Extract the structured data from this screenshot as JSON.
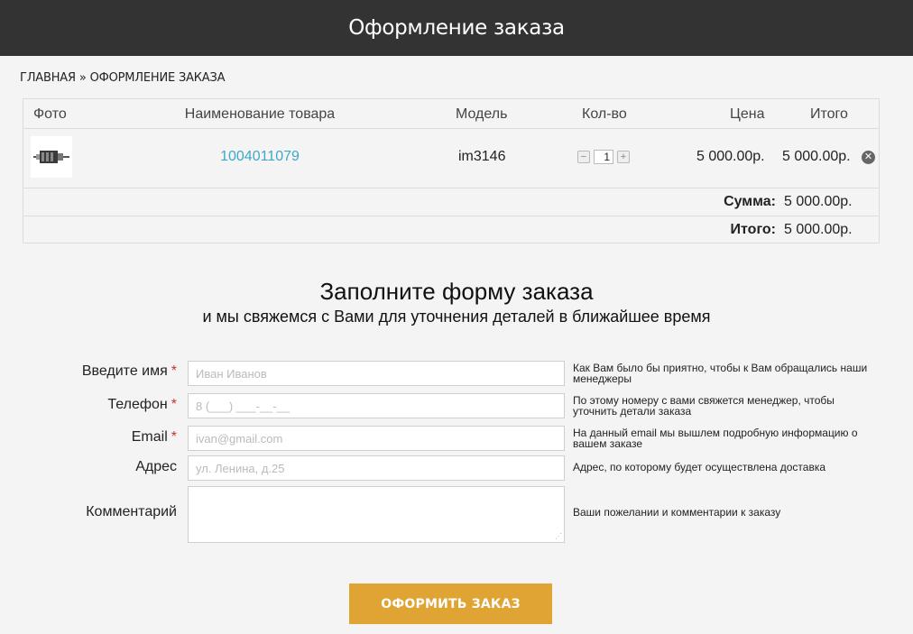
{
  "header": {
    "title": "Оформление заказа"
  },
  "breadcrumb": {
    "home": "Главная",
    "separator": "»",
    "current": "Оформление заказа"
  },
  "cart": {
    "columns": {
      "photo": "Фото",
      "name": "Наименование товара",
      "model": "Модель",
      "qty": "Кол-во",
      "price": "Цена",
      "total": "Итого"
    },
    "items": [
      {
        "name": "1004011079",
        "model": "im3146",
        "qty": "1",
        "price": "5 000.00р.",
        "total": "5 000.00р.",
        "qty_minus_icon": "minus-icon",
        "qty_plus_icon": "plus-icon",
        "remove_icon": "close-icon"
      }
    ],
    "sum_label": "Сумма:",
    "sum_value": "5 000.00р.",
    "total_label": "Итого:",
    "total_value": "5 000.00р."
  },
  "form": {
    "title": "Заполните форму заказа",
    "subtitle": "и мы свяжемся с Вами для уточнения деталей в ближайшее время",
    "required_mark": "*",
    "fields": {
      "name": {
        "label": "Введите имя",
        "placeholder": "Иван Иванов",
        "hint": "Как Вам было бы приятно, чтобы к Вам обращались наши менеджеры"
      },
      "phone": {
        "label": "Телефон",
        "placeholder": "8 (___) ___-__-__",
        "hint": "По этому номеру с вами свяжется менеджер, чтобы уточнить детали заказа"
      },
      "email": {
        "label": "Email",
        "placeholder": "ivan@gmail.com",
        "hint": "На данный email мы вышлем подробную информацию о вашем заказе"
      },
      "address": {
        "label": "Адрес",
        "placeholder": "ул. Ленина, д.25",
        "hint": "Адрес, по которому будет осуществлена доставка"
      },
      "comment": {
        "label": "Комментарий",
        "placeholder": "",
        "hint": "Ваши пожелании и комментарии к заказу"
      }
    },
    "submit_label": "Оформить заказ"
  },
  "colors": {
    "topbar": "#333333",
    "link": "#3fa8c8",
    "accent": "#e0a434",
    "required": "#c0392b"
  }
}
